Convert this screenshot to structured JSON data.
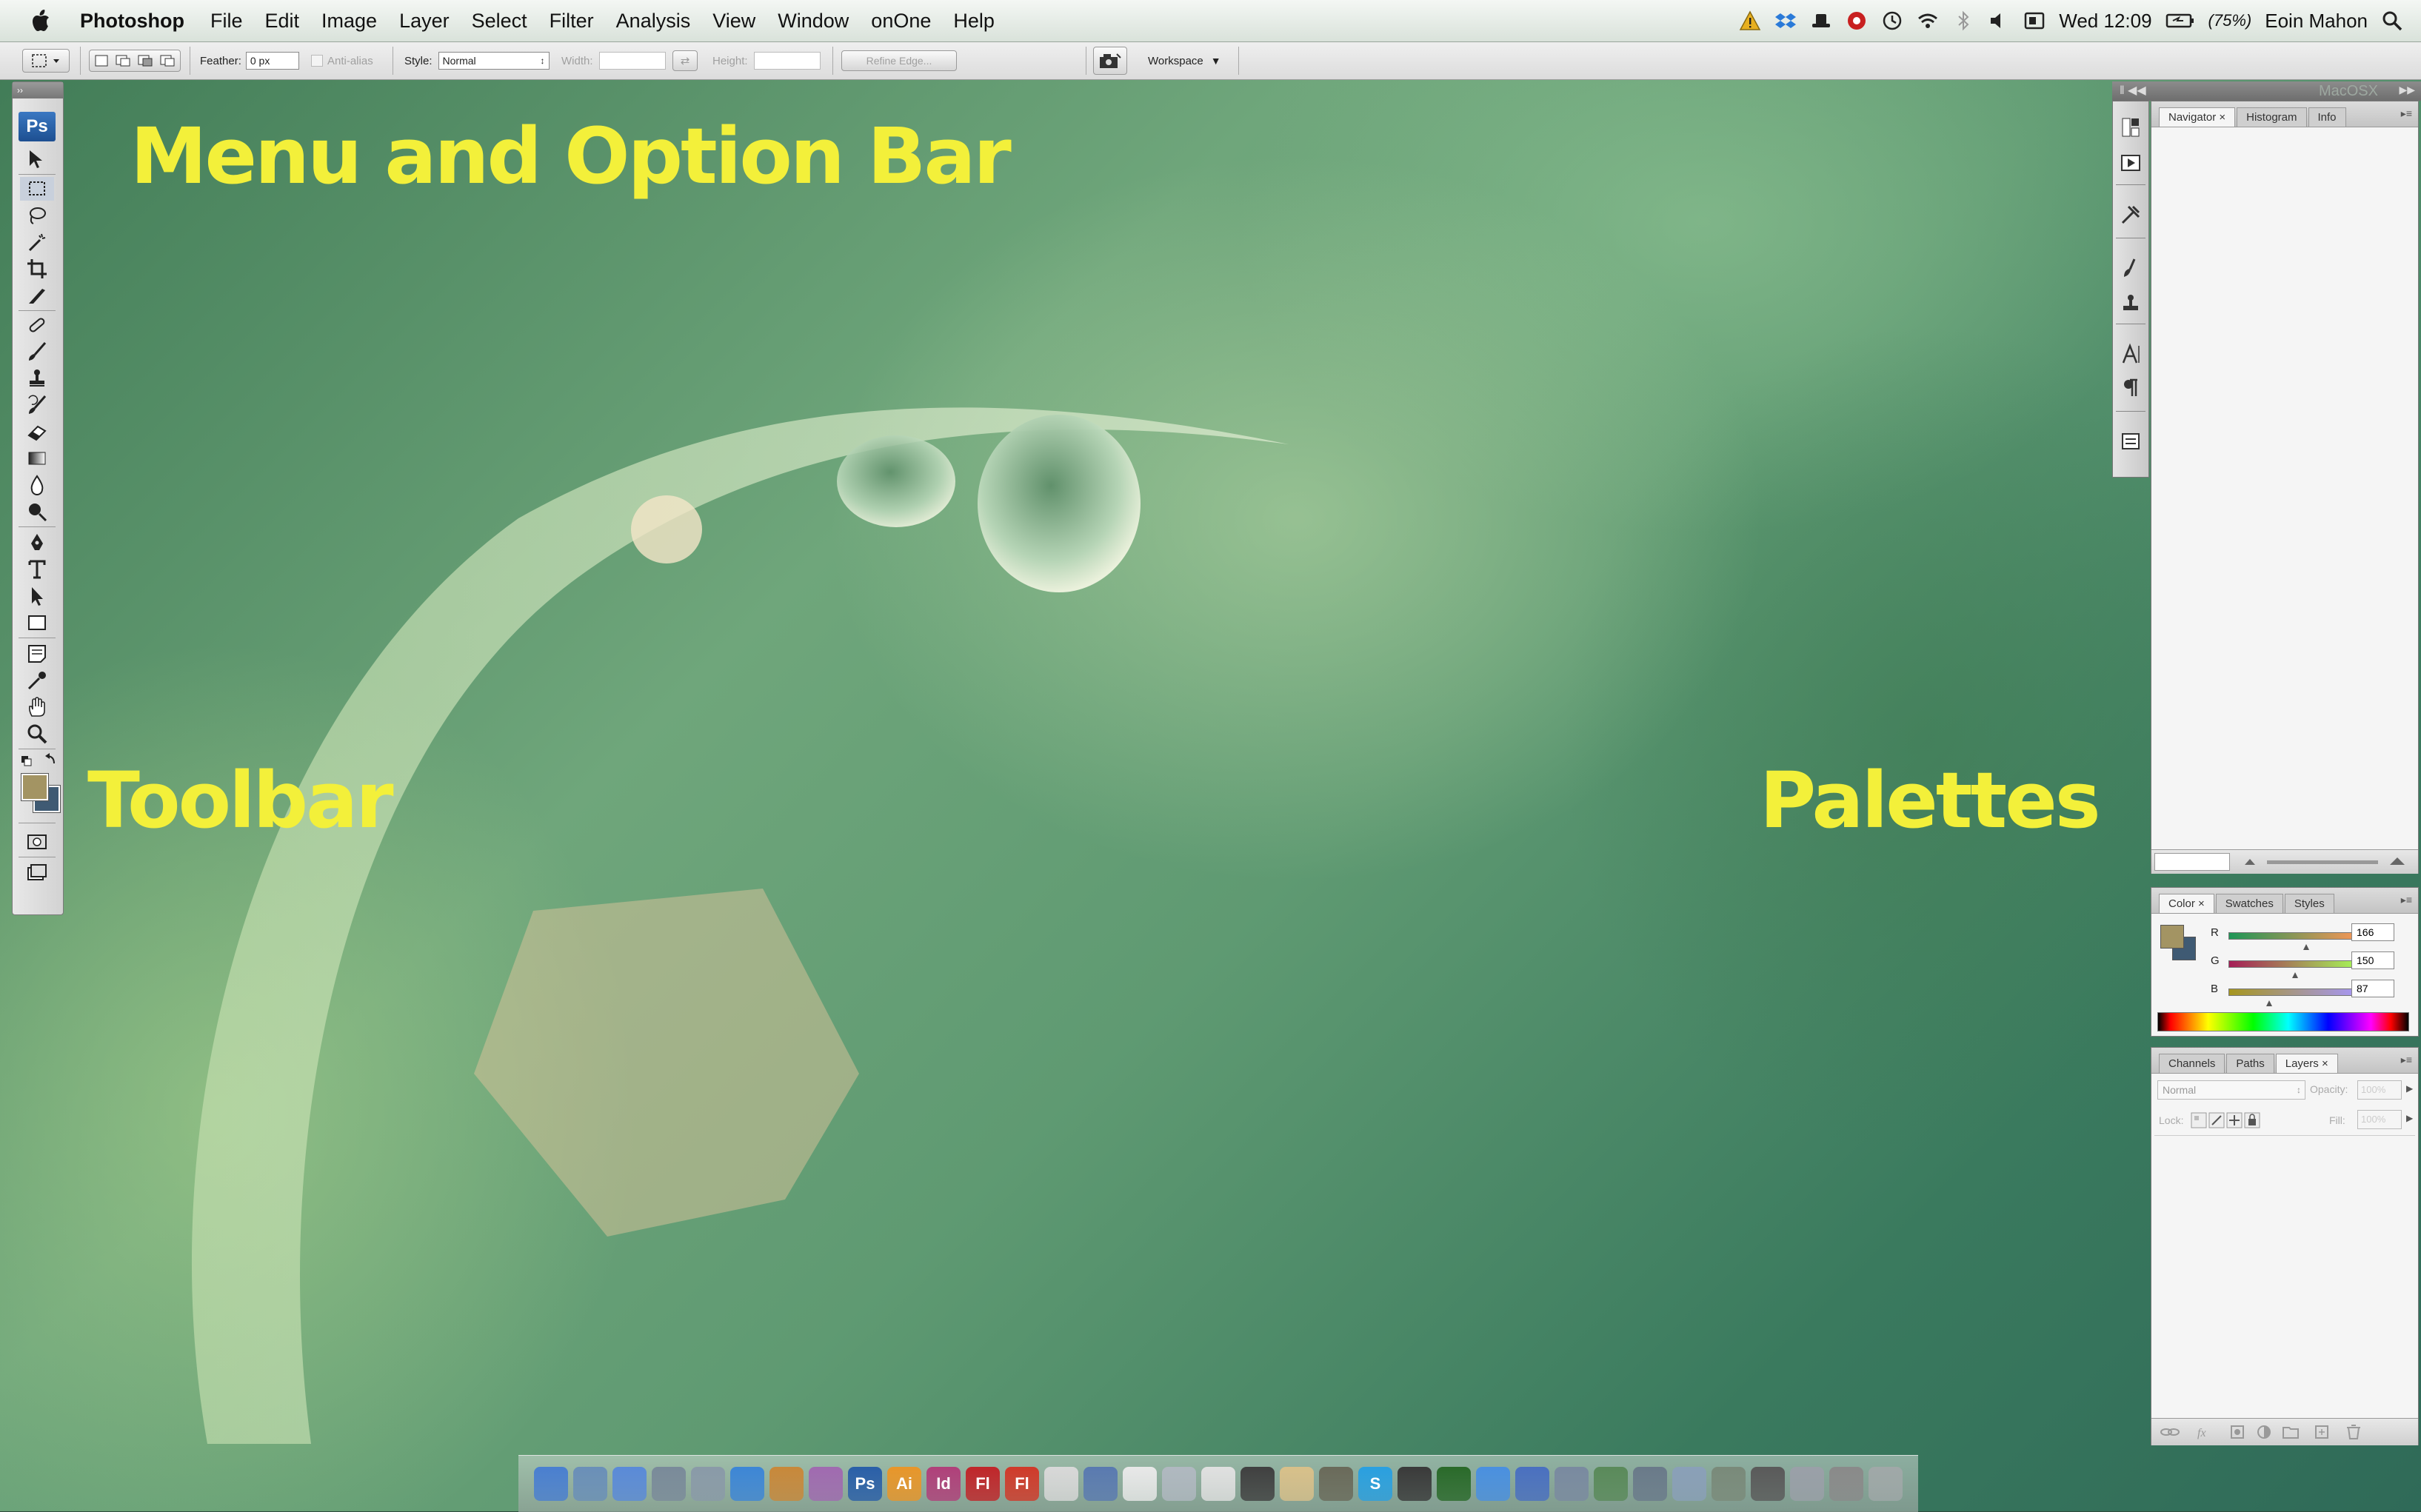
{
  "menubar": {
    "app_name": "Photoshop",
    "menus": [
      "File",
      "Edit",
      "Image",
      "Layer",
      "Select",
      "Filter",
      "Analysis",
      "View",
      "Window",
      "onOne",
      "Help"
    ],
    "status_icons": [
      "warning-icon",
      "dropbox-icon",
      "hat-icon",
      "record-icon",
      "time-machine-icon",
      "wifi-icon",
      "bluetooth-icon",
      "volume-icon",
      "screen-icon"
    ],
    "clock": "Wed 12:09",
    "battery": "(75%)",
    "user": "Eoin Mahon"
  },
  "options": {
    "feather_label": "Feather:",
    "feather_value": "0 px",
    "antialias_label": "Anti-alias",
    "style_label": "Style:",
    "style_value": "Normal",
    "width_label": "Width:",
    "height_label": "Height:",
    "refine_edge": "Refine Edge...",
    "workspace": "Workspace"
  },
  "toolbar": {
    "logo": "Ps",
    "tools": [
      "move-tool",
      "marquee-tool",
      "lasso-tool",
      "magic-wand-tool",
      "crop-tool",
      "slice-tool",
      "healing-brush-tool",
      "brush-tool",
      "clone-stamp-tool",
      "history-brush-tool",
      "eraser-tool",
      "gradient-tool",
      "blur-tool",
      "dodge-tool",
      "pen-tool",
      "type-tool",
      "path-selection-tool",
      "shape-tool",
      "notes-tool",
      "eyedropper-tool",
      "hand-tool",
      "zoom-tool"
    ],
    "foreground_color": "#a39463",
    "background_color": "#3f5a73"
  },
  "palettes": {
    "header_title": "MacOSX",
    "navigator_tabs": [
      "Navigator",
      "Histogram",
      "Info"
    ],
    "color_tabs": [
      "Color",
      "Swatches",
      "Styles"
    ],
    "color_sliders": [
      {
        "label": "R",
        "value": "166"
      },
      {
        "label": "G",
        "value": "150"
      },
      {
        "label": "B",
        "value": "87"
      }
    ],
    "layers_tabs": [
      "Channels",
      "Paths",
      "Layers"
    ],
    "blend_mode": "Normal",
    "opacity_label": "Opacity:",
    "opacity_value": "100%",
    "lock_label": "Lock:",
    "fill_label": "Fill:",
    "fill_value": "100%"
  },
  "dock": {
    "icons": [
      {
        "name": "finder",
        "color": "#4a7fd0",
        "text": ""
      },
      {
        "name": "preview",
        "color": "#6a8fb8",
        "text": ""
      },
      {
        "name": "itunes",
        "color": "#5a8ad8",
        "text": ""
      },
      {
        "name": "system-prefs",
        "color": "#7a8a9a",
        "text": ""
      },
      {
        "name": "iphoto",
        "color": "#8a9aa8",
        "text": ""
      },
      {
        "name": "safari",
        "color": "#3d86d6",
        "text": ""
      },
      {
        "name": "photo-app",
        "color": "#c8883a",
        "text": ""
      },
      {
        "name": "aperture",
        "color": "#a06ab0",
        "text": ""
      },
      {
        "name": "photoshop",
        "color": "#2a5fa8",
        "text": "Ps"
      },
      {
        "name": "illustrator",
        "color": "#e8962a",
        "text": "Ai"
      },
      {
        "name": "indesign",
        "color": "#b0407a",
        "text": "Id"
      },
      {
        "name": "flash",
        "color": "#c0262a",
        "text": "Fl"
      },
      {
        "name": "flash-2",
        "color": "#d03a2a",
        "text": "Fl"
      },
      {
        "name": "acrobat",
        "color": "#d8d8d8",
        "text": ""
      },
      {
        "name": "ical-todo",
        "color": "#5a7ab0",
        "text": ""
      },
      {
        "name": "ical",
        "color": "#e8e8e8",
        "text": ""
      },
      {
        "name": "clock",
        "color": "#b0b8c0",
        "text": ""
      },
      {
        "name": "textedit",
        "color": "#e0e0e0",
        "text": ""
      },
      {
        "name": "spade",
        "color": "#404040",
        "text": ""
      },
      {
        "name": "notes",
        "color": "#d8c08a",
        "text": ""
      },
      {
        "name": "bottle",
        "color": "#6a6a5a",
        "text": ""
      },
      {
        "name": "skype",
        "color": "#2aa0e0",
        "text": "S"
      },
      {
        "name": "compass",
        "color": "#3a3a3a",
        "text": ""
      },
      {
        "name": "terminal",
        "color": "#2a6a2a",
        "text": ""
      },
      {
        "name": "app-store",
        "color": "#4a90e0",
        "text": ""
      },
      {
        "name": "mail",
        "color": "#4a70c0",
        "text": ""
      },
      {
        "name": "quill",
        "color": "#7a8aa0",
        "text": ""
      },
      {
        "name": "activity",
        "color": "#5a8a5a",
        "text": ""
      },
      {
        "name": "archive",
        "color": "#6a7a8a",
        "text": ""
      },
      {
        "name": "vmware",
        "color": "#8aa0b8",
        "text": ""
      },
      {
        "name": "tools",
        "color": "#7a8a7a",
        "text": ""
      },
      {
        "name": "calculator",
        "color": "#5a5a5a",
        "text": ""
      },
      {
        "name": "rocket",
        "color": "#9aa0a8",
        "text": ""
      },
      {
        "name": "disk",
        "color": "#8a8a8a",
        "text": ""
      },
      {
        "name": "trash",
        "color": "#a0a8a8",
        "text": ""
      }
    ]
  },
  "annotations": {
    "menu_option": "Menu and Option Bar",
    "toolbar": "Toolbar",
    "palettes": "Palettes"
  }
}
